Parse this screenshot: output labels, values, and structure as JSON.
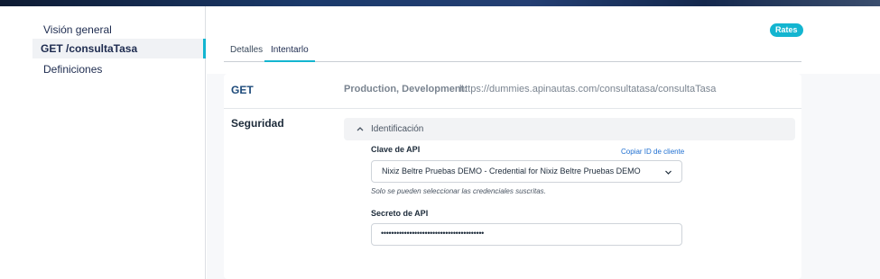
{
  "sidebar": {
    "items": [
      {
        "label": "Visión general"
      },
      {
        "label": "GET /consultaTasa"
      },
      {
        "label": "Definiciones"
      }
    ]
  },
  "badge": {
    "label": "Rates"
  },
  "tabs": [
    {
      "label": "Detalles"
    },
    {
      "label": "Intentarlo"
    }
  ],
  "endpoint": {
    "method": "GET",
    "environments_label": "Production, Development:",
    "url": "https://dummies.apinautas.com/consultatasa/consultaTasa"
  },
  "security": {
    "title": "Seguridad",
    "accordion_label": "Identificación",
    "api_key_label": "Clave de API",
    "copy_client_id": "Copiar ID de cliente",
    "api_key_selected": "Nixiz Beltre Pruebas DEMO - Credential for Nixiz Beltre Pruebas DEMO",
    "hint": "Solo se pueden seleccionar las credenciales suscritas.",
    "api_secret_label": "Secreto de API",
    "api_secret_value": "••••••••••••••••••••••••••••••••••••••••"
  }
}
